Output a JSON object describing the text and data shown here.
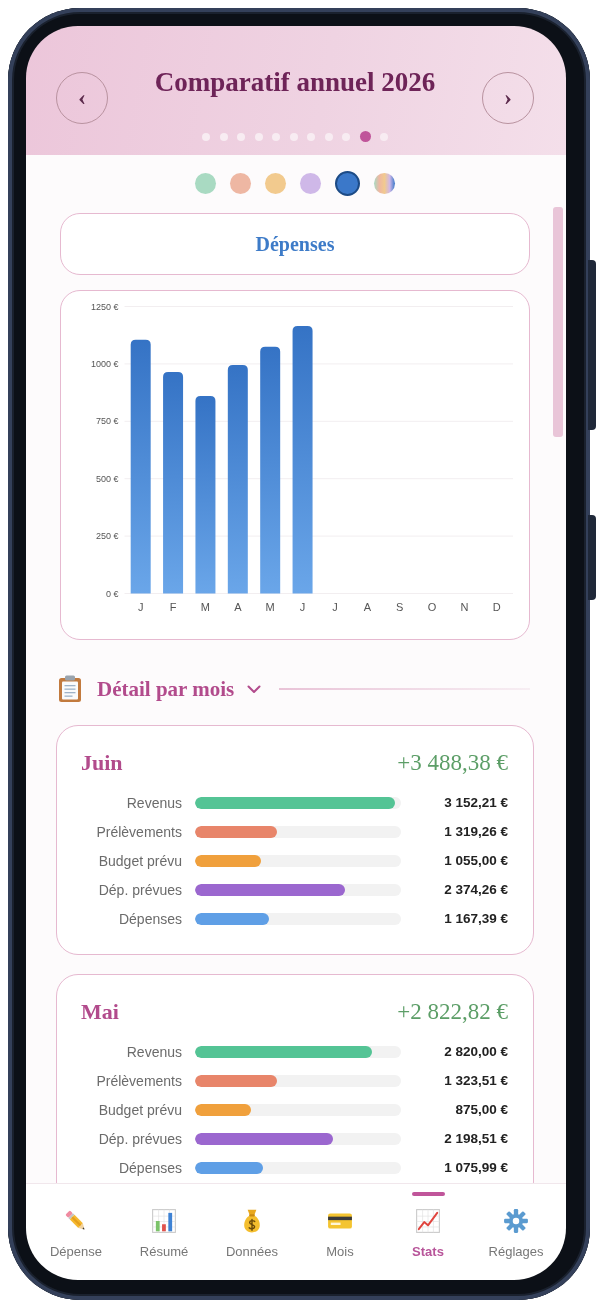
{
  "header": {
    "title": "Comparatif annuel 2026",
    "prev_button": "‹",
    "next_button": "›",
    "pages": [
      {
        "selected": false
      },
      {
        "selected": false
      },
      {
        "selected": false
      },
      {
        "selected": false
      },
      {
        "selected": false
      },
      {
        "selected": false
      },
      {
        "selected": false
      },
      {
        "selected": false
      },
      {
        "selected": false
      },
      {
        "selected": true
      },
      {
        "selected": false
      }
    ]
  },
  "series_selector": [
    {
      "kind": "single",
      "color": "#a9dac2",
      "selected": false
    },
    {
      "kind": "single",
      "color": "#eeb7a3",
      "selected": false
    },
    {
      "kind": "single",
      "color": "#f2ca8e",
      "selected": false
    },
    {
      "kind": "single",
      "color": "#cfb8e8",
      "selected": false
    },
    {
      "kind": "single",
      "color": "#3b78c9",
      "selected": true
    },
    {
      "kind": "all",
      "selected": false
    }
  ],
  "metric": {
    "label": "Dépenses"
  },
  "chart": {
    "chart_data": {
      "type": "bar",
      "grid": true,
      "categories": [
        "J",
        "F",
        "M",
        "A",
        "M",
        "J",
        "J",
        "A",
        "S",
        "O",
        "N",
        "D"
      ],
      "values": [
        1105,
        965,
        860,
        995,
        1075,
        1165,
        null,
        null,
        null,
        null,
        null,
        null
      ],
      "ylim": [
        0,
        1250
      ],
      "yticks": [
        {
          "value": 0,
          "label": "0 €"
        },
        {
          "value": 250,
          "label": "250 €"
        },
        {
          "value": 500,
          "label": "500 €"
        },
        {
          "value": 750,
          "label": "750 €"
        },
        {
          "value": 1000,
          "label": "1000 €"
        },
        {
          "value": 1250,
          "label": "1250 €"
        }
      ]
    }
  },
  "detail": {
    "title": "Détail par mois",
    "expanded": true,
    "months": [
      {
        "name": "Juin",
        "total": "+3 488,38 €",
        "rows": [
          {
            "label": "Revenus",
            "level": 0.97,
            "value": "3 152,21 €",
            "color": "#54c495"
          },
          {
            "label": "Prélèvements",
            "level": 0.4,
            "value": "1 319,26 €",
            "color": "#e8856a"
          },
          {
            "label": "Budget prévu",
            "level": 0.32,
            "value": "1 055,00 €",
            "color": "#f0a03c"
          },
          {
            "label": "Dép. prévues",
            "level": 0.73,
            "value": "2 374,26 €",
            "color": "#9b67cf"
          },
          {
            "label": "Dépenses",
            "level": 0.36,
            "value": "1 167,39 €",
            "color": "#5f9fe6"
          }
        ]
      },
      {
        "name": "Mai",
        "total": "+2 822,82 €",
        "rows": [
          {
            "label": "Revenus",
            "level": 0.86,
            "value": "2 820,00 €",
            "color": "#54c495"
          },
          {
            "label": "Prélèvements",
            "level": 0.4,
            "value": "1 323,51 €",
            "color": "#e8856a"
          },
          {
            "label": "Budget prévu",
            "level": 0.27,
            "value": "875,00 €",
            "color": "#f0a03c"
          },
          {
            "label": "Dép. prévues",
            "level": 0.67,
            "value": "2 198,51 €",
            "color": "#9b67cf"
          },
          {
            "label": "Dépenses",
            "level": 0.33,
            "value": "1 075,99 €",
            "color": "#5f9fe6"
          }
        ]
      }
    ]
  },
  "nav": {
    "items": [
      {
        "label": "Dépense",
        "selected": false
      },
      {
        "label": "Résumé",
        "selected": false
      },
      {
        "label": "Données",
        "selected": false
      },
      {
        "label": "Mois",
        "selected": false
      },
      {
        "label": "Stats",
        "selected": true
      },
      {
        "label": "Réglages",
        "selected": false
      }
    ]
  }
}
